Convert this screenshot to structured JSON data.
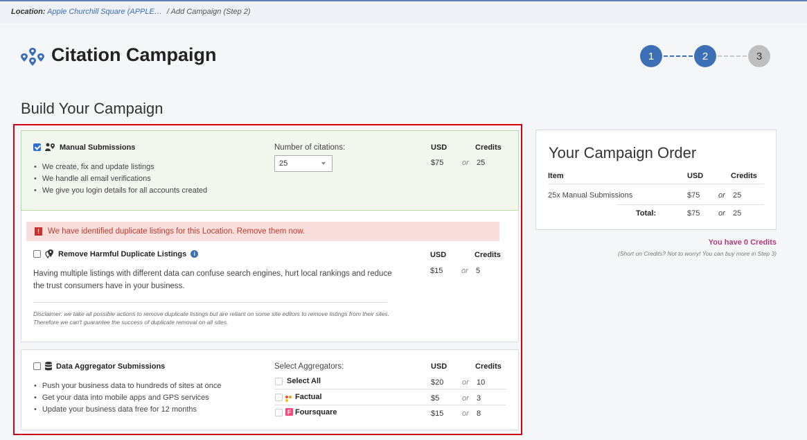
{
  "breadcrumb": {
    "location_label": "Location:",
    "location_name": "Apple Churchill Square (APPLE…",
    "current": "/ Add Campaign (Step 2)"
  },
  "page": {
    "title": "Citation Campaign",
    "build_title": "Build Your Campaign"
  },
  "stepper": {
    "steps": [
      "1",
      "2",
      "3"
    ],
    "current": 2
  },
  "manual": {
    "title": "Manual Submissions",
    "checked": true,
    "features": [
      "We create, fix and update listings",
      "We handle all email verifications",
      "We give you login details for all accounts created"
    ],
    "citations_label": "Number of citations:",
    "citations_value": "25",
    "usd_header": "USD",
    "credits_header": "Credits",
    "usd": "$75",
    "or": "or",
    "credits": "25"
  },
  "duplicates": {
    "alert": "We have identified duplicate listings for this Location. Remove them now.",
    "title": "Remove Harmful Duplicate Listings",
    "checked": false,
    "description": "Having multiple listings with different data can confuse search engines, hurt local rankings and reduce the trust consumers have in your business.",
    "disclaimer": "Disclaimer: we take all possible actions to remove duplicate listings but are reliant on some site editors to remove listings from their sites. Therefore we can't guarantee the success of duplicate removal on all sites.",
    "usd_header": "USD",
    "credits_header": "Credits",
    "usd": "$15",
    "or": "or",
    "credits": "5"
  },
  "aggregator": {
    "title": "Data Aggregator Submissions",
    "checked": false,
    "features": [
      "Push your business data to hundreds of sites at once",
      "Get your data into mobile apps and GPS services",
      "Update your business data free for 12 months"
    ],
    "select_label": "Select Aggregators:",
    "usd_header": "USD",
    "credits_header": "Credits",
    "options": [
      {
        "label": "Select All",
        "usd": "$20",
        "or": "or",
        "credits": "10"
      },
      {
        "label": "Factual",
        "usd": "$5",
        "or": "or",
        "credits": "3"
      },
      {
        "label": "Foursquare",
        "usd": "$15",
        "or": "or",
        "credits": "8"
      }
    ]
  },
  "order": {
    "title": "Your Campaign Order",
    "headers": {
      "item": "Item",
      "usd": "USD",
      "credits": "Credits"
    },
    "rows": [
      {
        "item": "25x Manual Submissions",
        "usd": "$75",
        "or": "or",
        "credits": "25"
      }
    ],
    "total": {
      "label": "Total:",
      "usd": "$75",
      "or": "or",
      "credits": "25"
    }
  },
  "credits_note": {
    "balance": "You have 0 Credits",
    "hint": "(Short on Credits? Not to worry! You can buy more in Step 3)"
  },
  "colors": {
    "accent": "#3d6fb6",
    "alert": "#c0392b",
    "highlight_border": "#d0021b",
    "selected_bg": "#f1f7ec"
  }
}
